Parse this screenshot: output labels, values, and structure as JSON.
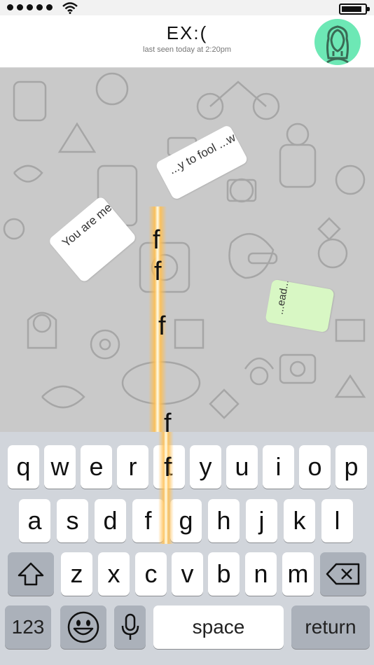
{
  "header": {
    "contact_name": "EX:(",
    "last_seen": "last seen today at 2:20pm"
  },
  "messages": [
    {
      "text": "You are me...",
      "type": "incoming"
    },
    {
      "text": "...y to fool ...writ...",
      "type": "incoming"
    },
    {
      "text": "...ead...",
      "type": "outgoing"
    }
  ],
  "flying_letters": [
    "f",
    "f",
    "f",
    "f",
    "f"
  ],
  "keyboard": {
    "row1": [
      "q",
      "w",
      "e",
      "r",
      "t",
      "y",
      "u",
      "i",
      "o",
      "p"
    ],
    "row2": [
      "a",
      "s",
      "d",
      "f",
      "g",
      "h",
      "j",
      "k",
      "l"
    ],
    "row3": [
      "z",
      "x",
      "c",
      "v",
      "b",
      "n",
      "m"
    ],
    "numbers_label": "123",
    "space_label": "space",
    "return_label": "return"
  },
  "colors": {
    "avatar_bg": "#6de8b5",
    "chat_bg": "#c9c9c9",
    "outgoing_bubble": "#d8f7c4",
    "keyboard_bg": "#d1d5db"
  },
  "icons": [
    "wifi-icon",
    "battery-icon",
    "avatar-icon",
    "shift-icon",
    "backspace-icon",
    "emoji-icon",
    "microphone-icon"
  ]
}
